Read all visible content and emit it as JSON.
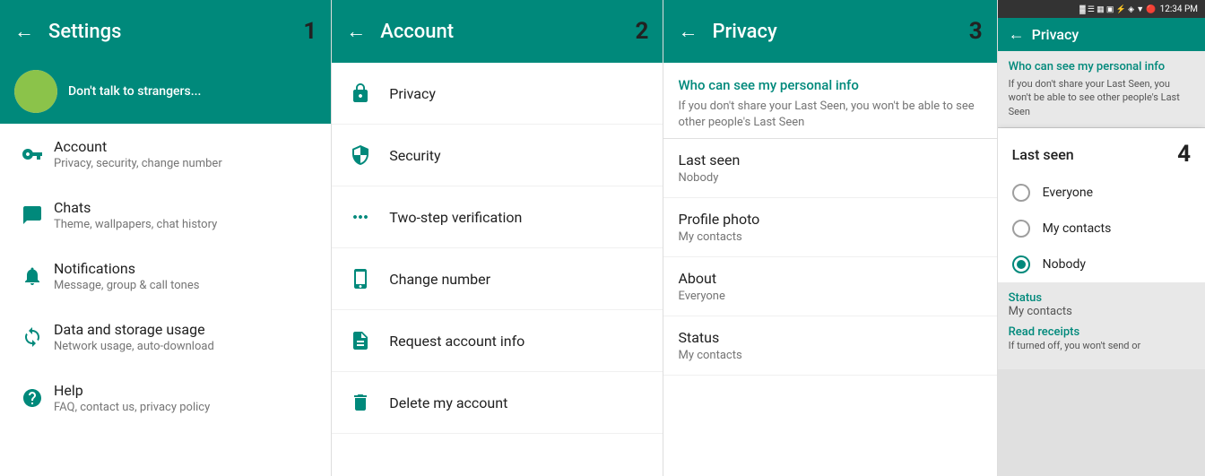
{
  "panel1": {
    "header": {
      "back": "←",
      "title": "Settings",
      "num": "1"
    },
    "profile": {
      "name": "Don't talk to strangers..."
    },
    "menu_items": [
      {
        "label": "Account",
        "sublabel": "Privacy, security, change number",
        "icon": "key"
      },
      {
        "label": "Chats",
        "sublabel": "Theme, wallpapers, chat history",
        "icon": "chat"
      },
      {
        "label": "Notifications",
        "sublabel": "Message, group & call tones",
        "icon": "bell"
      },
      {
        "label": "Data and storage usage",
        "sublabel": "Network usage, auto-download",
        "icon": "refresh"
      },
      {
        "label": "Help",
        "sublabel": "FAQ, contact us, privacy policy",
        "icon": "help"
      }
    ]
  },
  "panel2": {
    "header": {
      "back": "←",
      "title": "Account",
      "num": "2"
    },
    "items": [
      {
        "label": "Privacy",
        "icon": "lock"
      },
      {
        "label": "Security",
        "icon": "shield"
      },
      {
        "label": "Two-step verification",
        "icon": "dots"
      },
      {
        "label": "Change number",
        "icon": "phone"
      },
      {
        "label": "Request account info",
        "icon": "document"
      },
      {
        "label": "Delete my account",
        "icon": "trash"
      }
    ]
  },
  "panel3": {
    "header": {
      "back": "←",
      "title": "Privacy",
      "num": "3"
    },
    "info": {
      "title": "Who can see my personal info",
      "text": "If you don't share your Last Seen, you won't be able to see other people's Last Seen"
    },
    "items": [
      {
        "label": "Last seen",
        "value": "Nobody"
      },
      {
        "label": "Profile photo",
        "value": "My contacts"
      },
      {
        "label": "About",
        "value": "Everyone"
      },
      {
        "label": "Status",
        "value": "My contacts"
      }
    ]
  },
  "panel4": {
    "statusbar": "12:34 PM",
    "topbar": {
      "back": "←",
      "title": "Privacy"
    },
    "bg_info": {
      "title": "Who can see my personal info",
      "text": "If you don't share your Last Seen, you won't be able to see other people's Last Seen"
    },
    "dialog": {
      "title": "Last seen",
      "num": "4",
      "options": [
        {
          "label": "Everyone",
          "selected": false
        },
        {
          "label": "My contacts",
          "selected": false
        },
        {
          "label": "Nobody",
          "selected": true
        }
      ]
    },
    "bottom": {
      "status_label": "Status",
      "status_value": "My contacts",
      "read_label": "Read receipts",
      "read_text": "If turned off, you won't send or"
    }
  }
}
